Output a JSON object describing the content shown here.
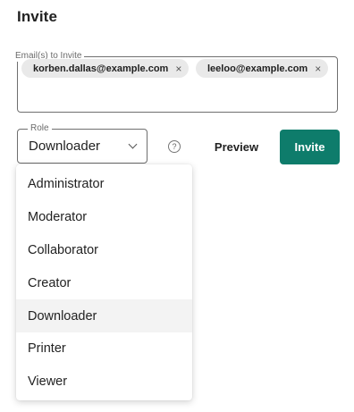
{
  "title": "Invite",
  "email_field": {
    "label": "Email(s) to Invite",
    "chips": [
      {
        "email": "korben.dallas@example.com",
        "remove_glyph": "×"
      },
      {
        "email": "leeloo@example.com",
        "remove_glyph": "×"
      }
    ]
  },
  "role": {
    "label": "Role",
    "value": "Downloader",
    "chevron_icon": "chevron-down-icon"
  },
  "help_glyph": "?",
  "buttons": {
    "preview": "Preview",
    "invite": "Invite"
  },
  "colors": {
    "accent": "#0e7c6b",
    "chip_bg": "#e9e9e9",
    "selected_bg": "#f3f3f3"
  },
  "menu": {
    "items": [
      {
        "label": "Administrator"
      },
      {
        "label": "Moderator"
      },
      {
        "label": "Collaborator"
      },
      {
        "label": "Creator"
      },
      {
        "label": "Downloader",
        "selected": true
      },
      {
        "label": "Printer"
      },
      {
        "label": "Viewer"
      }
    ]
  }
}
